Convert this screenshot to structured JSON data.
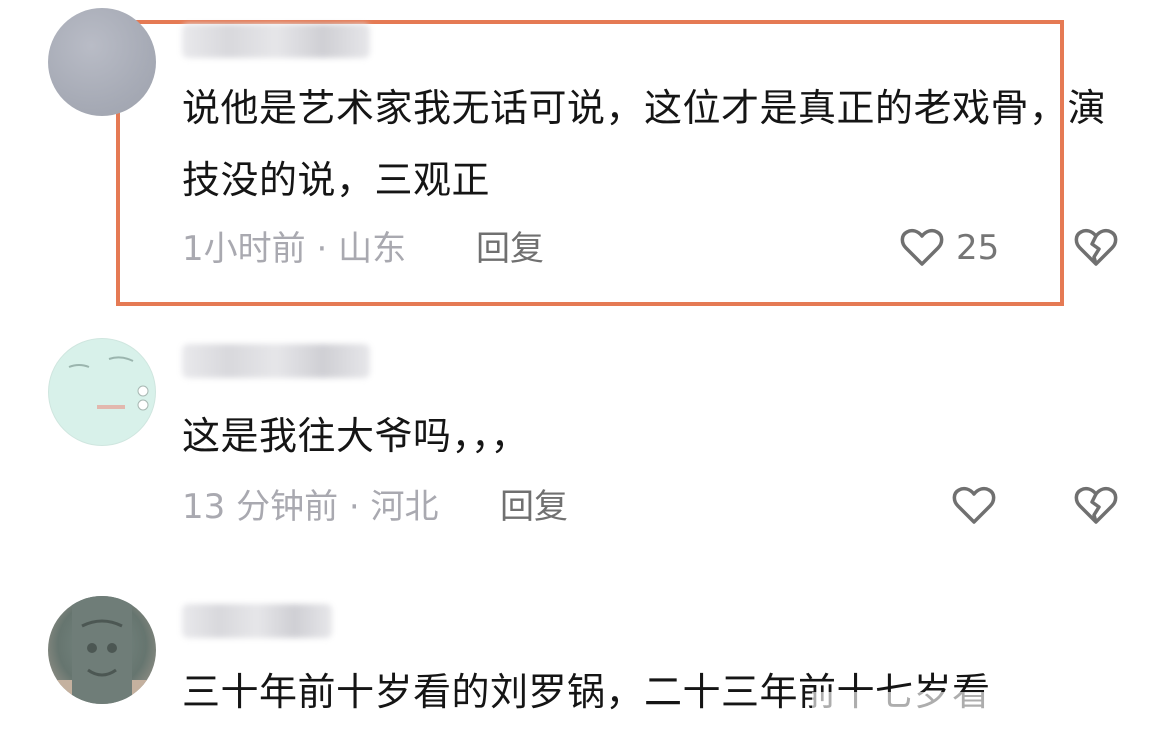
{
  "comments": [
    {
      "text": "说他是艺术家我无话可说，这位才是真正的老戏骨，演技没的说，三观正",
      "time": "1小时前",
      "location": "山东",
      "reply_label": "回复",
      "likes": "25"
    },
    {
      "text": "这是我往大爷吗，，，",
      "time": "13 分钟前",
      "location": "河北",
      "reply_label": "回复"
    },
    {
      "text": "三十年前十岁看的刘罗锅，二十三年前十七岁看"
    }
  ],
  "colors": {
    "highlight_border": "#e57a54",
    "text": "#151515",
    "meta": "#a9a9b0",
    "reply": "#707070"
  },
  "icons": {
    "like": "heart-outline-icon",
    "dislike": "broken-heart-icon"
  }
}
